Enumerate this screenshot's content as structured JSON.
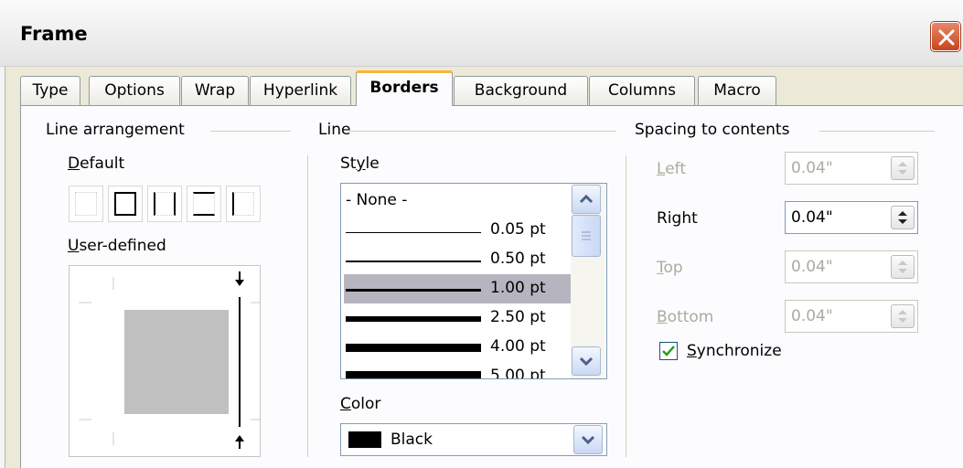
{
  "window": {
    "title": "Frame"
  },
  "tabs": [
    {
      "label": "Type"
    },
    {
      "label": "Options"
    },
    {
      "label": "Wrap"
    },
    {
      "label": "Hyperlink"
    },
    {
      "label": "Borders",
      "active": true
    },
    {
      "label": "Background"
    },
    {
      "label": "Columns"
    },
    {
      "label": "Macro"
    }
  ],
  "line_arrangement": {
    "heading": "Line arrangement",
    "default_label": "Default",
    "user_defined_label": "User-defined"
  },
  "line": {
    "heading": "Line",
    "style_label": "Style",
    "styles": [
      {
        "label": "- None -"
      },
      {
        "label": "0.05 pt"
      },
      {
        "label": "0.50 pt"
      },
      {
        "label": "1.00 pt",
        "selected": true
      },
      {
        "label": "2.50 pt"
      },
      {
        "label": "4.00 pt"
      },
      {
        "label": "5.00 pt"
      }
    ],
    "color_label": "Color",
    "color_value": "Black",
    "color_swatch": "#000000"
  },
  "spacing": {
    "heading": "Spacing to contents",
    "left": {
      "label": "Left",
      "value": "0.04\"",
      "enabled": false
    },
    "right": {
      "label": "Right",
      "value": "0.04\"",
      "enabled": true
    },
    "top": {
      "label": "Top",
      "value": "0.04\"",
      "enabled": false
    },
    "bottom": {
      "label": "Bottom",
      "value": "0.04\"",
      "enabled": false
    },
    "synchronize": {
      "label": "Synchronize",
      "checked": true
    }
  },
  "colors": {
    "tab_highlight": "#f8b636",
    "selection": "#b6b5bf",
    "disabled_text": "#acab9e"
  }
}
